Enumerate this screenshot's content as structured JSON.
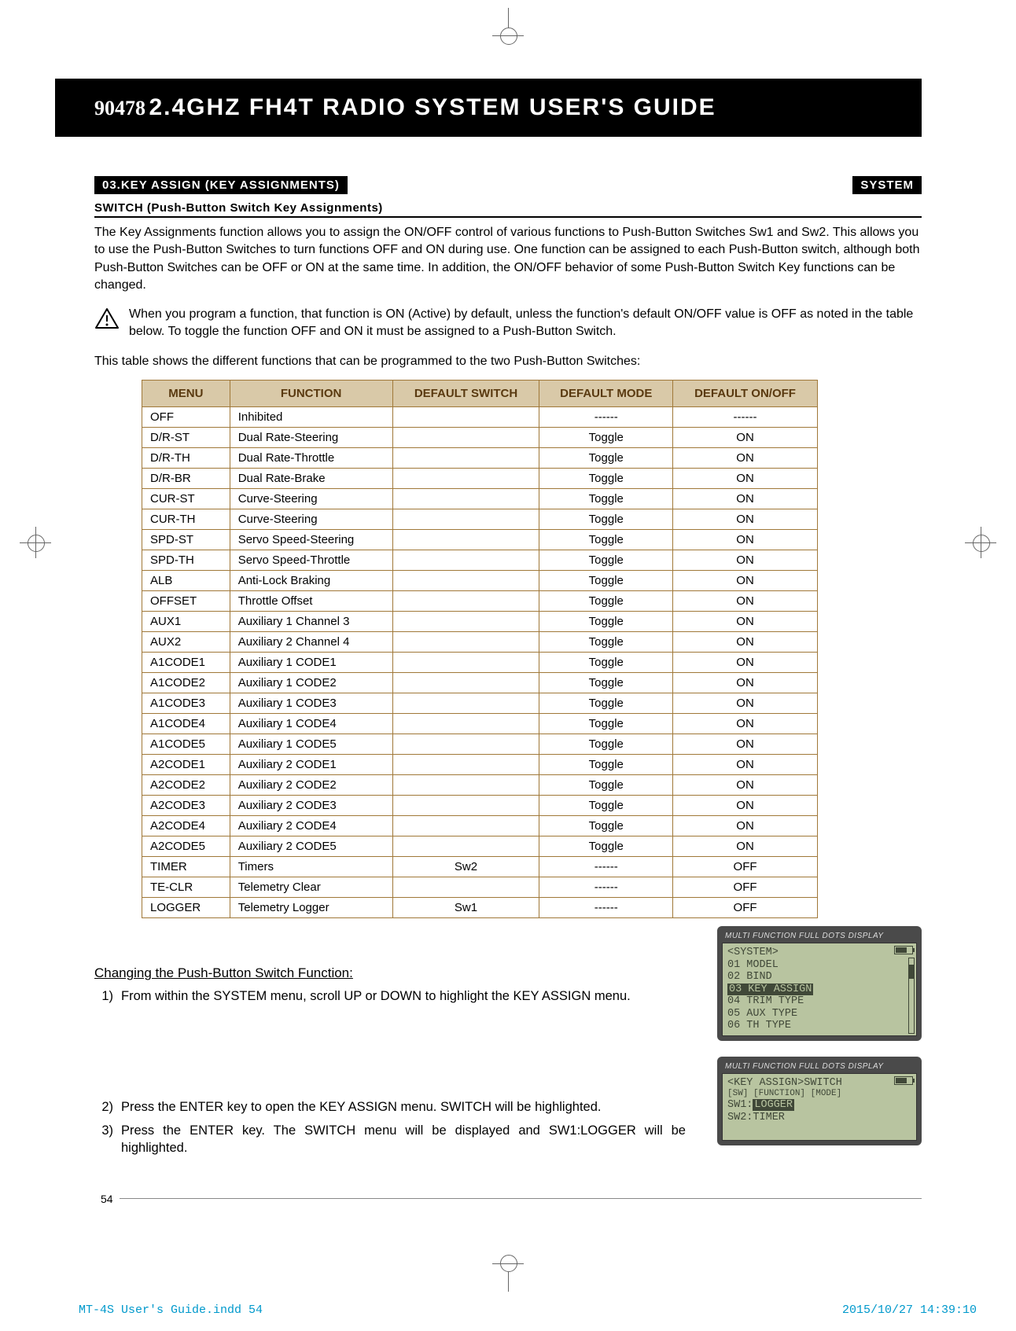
{
  "header": {
    "code": "90478",
    "title": "2.4GHZ FH4T RADIO SYSTEM USER'S GUIDE"
  },
  "section": {
    "left_tab": "03.KEY ASSIGN (KEY ASSIGNMENTS)",
    "right_tab": "SYSTEM",
    "subheading": "SWITCH (Push-Button Switch Key Assignments)"
  },
  "paragraphs": {
    "intro": "The Key Assignments function allows you to assign the ON/OFF control of various functions to Push-Button Switches Sw1 and Sw2. This allows you to use the Push-Button Switches to turn functions OFF and ON during use. One function can be assigned to each Push-Button switch, although both Push-Button Switches can be OFF or ON at the same time. In addition, the ON/OFF behavior of some Push-Button Switch Key functions can be changed.",
    "warning": "When you program a function, that function is ON (Active) by default, unless the function's default ON/OFF value is OFF as noted in the table below. To toggle the function OFF and ON it must be assigned to a Push-Button Switch.",
    "table_intro": "This table shows the different functions that can be programmed to the two Push-Button Switches:"
  },
  "table": {
    "headers": [
      "MENU",
      "FUNCTION",
      "DEFAULT SWITCH",
      "DEFAULT MODE",
      "DEFAULT ON/OFF"
    ],
    "rows": [
      [
        "OFF",
        "Inhibited",
        "",
        "------",
        "------"
      ],
      [
        "D/R-ST",
        "Dual Rate-Steering",
        "",
        "Toggle",
        "ON"
      ],
      [
        "D/R-TH",
        "Dual Rate-Throttle",
        "",
        "Toggle",
        "ON"
      ],
      [
        "D/R-BR",
        "Dual Rate-Brake",
        "",
        "Toggle",
        "ON"
      ],
      [
        "CUR-ST",
        "Curve-Steering",
        "",
        "Toggle",
        "ON"
      ],
      [
        "CUR-TH",
        "Curve-Steering",
        "",
        "Toggle",
        "ON"
      ],
      [
        "SPD-ST",
        "Servo Speed-Steering",
        "",
        "Toggle",
        "ON"
      ],
      [
        "SPD-TH",
        "Servo Speed-Throttle",
        "",
        "Toggle",
        "ON"
      ],
      [
        "ALB",
        "Anti-Lock Braking",
        "",
        "Toggle",
        "ON"
      ],
      [
        "OFFSET",
        "Throttle Offset",
        "",
        "Toggle",
        "ON"
      ],
      [
        "AUX1",
        "Auxiliary 1 Channel 3",
        "",
        "Toggle",
        "ON"
      ],
      [
        "AUX2",
        "Auxiliary 2 Channel 4",
        "",
        "Toggle",
        "ON"
      ],
      [
        "A1CODE1",
        "Auxiliary 1 CODE1",
        "",
        "Toggle",
        "ON"
      ],
      [
        "A1CODE2",
        "Auxiliary 1 CODE2",
        "",
        "Toggle",
        "ON"
      ],
      [
        "A1CODE3",
        "Auxiliary 1 CODE3",
        "",
        "Toggle",
        "ON"
      ],
      [
        "A1CODE4",
        "Auxiliary 1 CODE4",
        "",
        "Toggle",
        "ON"
      ],
      [
        "A1CODE5",
        "Auxiliary 1 CODE5",
        "",
        "Toggle",
        "ON"
      ],
      [
        "A2CODE1",
        "Auxiliary 2 CODE1",
        "",
        "Toggle",
        "ON"
      ],
      [
        "A2CODE2",
        "Auxiliary 2 CODE2",
        "",
        "Toggle",
        "ON"
      ],
      [
        "A2CODE3",
        "Auxiliary 2 CODE3",
        "",
        "Toggle",
        "ON"
      ],
      [
        "A2CODE4",
        "Auxiliary 2 CODE4",
        "",
        "Toggle",
        "ON"
      ],
      [
        "A2CODE5",
        "Auxiliary 2 CODE5",
        "",
        "Toggle",
        "ON"
      ],
      [
        "TIMER",
        "Timers",
        "Sw2",
        "------",
        "OFF"
      ],
      [
        "TE-CLR",
        "Telemetry Clear",
        "",
        "------",
        "OFF"
      ],
      [
        "LOGGER",
        "Telemetry Logger",
        "Sw1",
        "------",
        "OFF"
      ]
    ]
  },
  "instructions": {
    "heading": "Changing the Push-Button Switch Function:",
    "steps": [
      "From within the SYSTEM menu, scroll UP or DOWN to highlight the KEY ASSIGN menu.",
      "Press the ENTER key to open the KEY ASSIGN menu. SWITCH will be highlighted.",
      "Press the ENTER key. The SWITCH menu will be displayed and SW1:LOGGER will be highlighted."
    ]
  },
  "lcd1": {
    "title": "MULTI FUNCTION FULL DOTS DISPLAY",
    "lines": [
      "<SYSTEM>",
      "01 MODEL",
      "02 BIND",
      "03 KEY ASSIGN",
      "04 TRIM TYPE",
      "05 AUX TYPE",
      "06 TH TYPE"
    ],
    "highlight_index": 3
  },
  "lcd2": {
    "title": "MULTI FUNCTION FULL DOTS DISPLAY",
    "header": "<KEY ASSIGN>SWITCH",
    "cols": "[SW]   [FUNCTION]   [MODE]",
    "row1_pre": "SW1:",
    "row1_hl": "LOGGER",
    "row2": "SW2:TIMER"
  },
  "page_number": "54",
  "footer": {
    "left": "MT-4S User's Guide.indd   54",
    "right": "2015/10/27   14:39:10"
  }
}
